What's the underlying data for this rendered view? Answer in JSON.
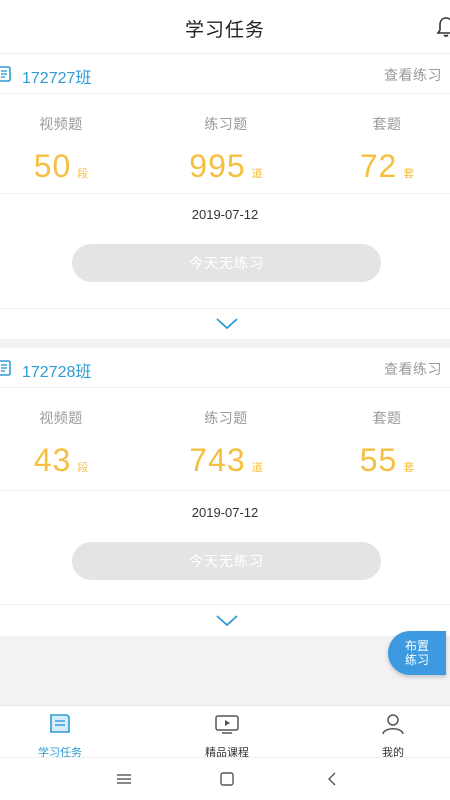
{
  "header": {
    "title": "学习任务",
    "icon": "bell-icon"
  },
  "cards": [
    {
      "class_name": "172727班",
      "view_link": "查看练习",
      "stats": [
        {
          "label": "视频题",
          "value": "50",
          "unit": "段"
        },
        {
          "label": "练习题",
          "value": "995",
          "unit": "道"
        },
        {
          "label": "套题",
          "value": "72",
          "unit": "套"
        }
      ],
      "date": "2019-07-12",
      "button": "今天无练习"
    },
    {
      "class_name": "172728班",
      "view_link": "查看练习",
      "stats": [
        {
          "label": "视频题",
          "value": "43",
          "unit": "段"
        },
        {
          "label": "练习题",
          "value": "743",
          "unit": "道"
        },
        {
          "label": "套题",
          "value": "55",
          "unit": "套"
        }
      ],
      "date": "2019-07-12",
      "button": "今天无练习"
    }
  ],
  "fab": {
    "line1": "布置",
    "line2": "练习"
  },
  "tabbar": [
    {
      "label": "学习任务",
      "icon": "task-icon",
      "active": true
    },
    {
      "label": "精品课程",
      "icon": "video-icon",
      "active": false
    },
    {
      "label": "我的",
      "icon": "user-icon",
      "active": false
    }
  ],
  "colors": {
    "accent": "#2d9bd6",
    "number": "#f5c040",
    "fab": "#3d9ae0"
  }
}
